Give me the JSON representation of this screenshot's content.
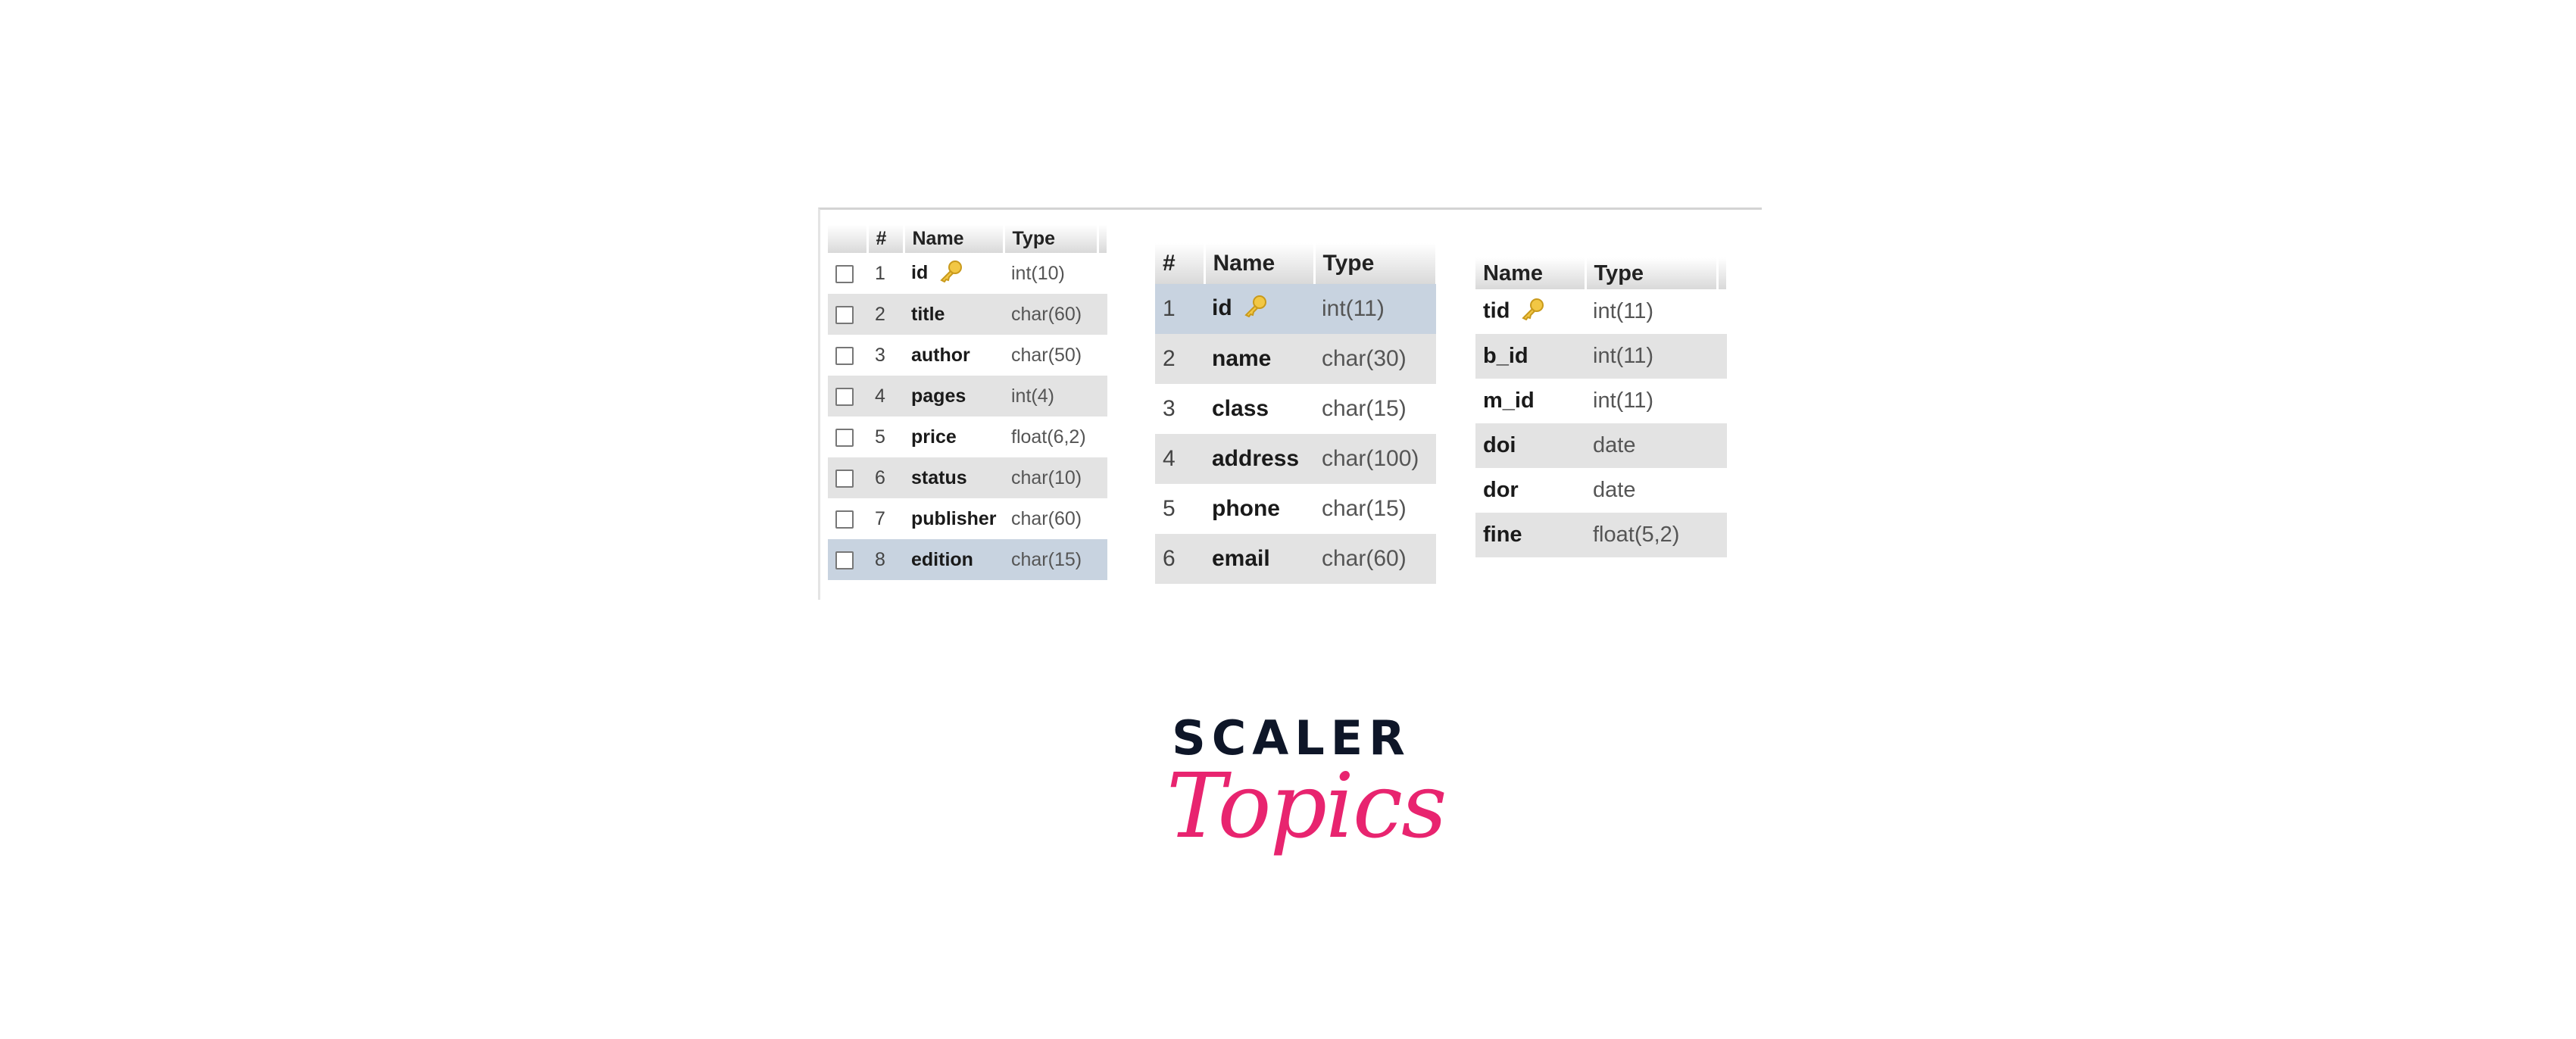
{
  "colors": {
    "accent_pink": "#e8246f",
    "logo_navy": "#0e1628",
    "row_gray": "#e3e3e3",
    "row_selected": "#c8d3e0"
  },
  "table1": {
    "headers": [
      "#",
      "Name",
      "Type"
    ],
    "rows": [
      {
        "num": "1",
        "name": "id",
        "type": "int(10)",
        "primary_key": true,
        "style": "odd"
      },
      {
        "num": "2",
        "name": "title",
        "type": "char(60)",
        "style": "even"
      },
      {
        "num": "3",
        "name": "author",
        "type": "char(50)",
        "style": "odd"
      },
      {
        "num": "4",
        "name": "pages",
        "type": "int(4)",
        "style": "even"
      },
      {
        "num": "5",
        "name": "price",
        "type": "float(6,2)",
        "style": "odd"
      },
      {
        "num": "6",
        "name": "status",
        "type": "char(10)",
        "style": "even"
      },
      {
        "num": "7",
        "name": "publisher",
        "type": "char(60)",
        "style": "odd"
      },
      {
        "num": "8",
        "name": "edition",
        "type": "char(15)",
        "style": "sel"
      }
    ]
  },
  "table2": {
    "headers": [
      "#",
      "Name",
      "Type"
    ],
    "rows": [
      {
        "num": "1",
        "name": "id",
        "type": "int(11)",
        "primary_key": true,
        "style": "sel"
      },
      {
        "num": "2",
        "name": "name",
        "type": "char(30)",
        "style": "even"
      },
      {
        "num": "3",
        "name": "class",
        "type": "char(15)",
        "style": "odd"
      },
      {
        "num": "4",
        "name": "address",
        "type": "char(100)",
        "style": "even"
      },
      {
        "num": "5",
        "name": "phone",
        "type": "char(15)",
        "style": "odd"
      },
      {
        "num": "6",
        "name": "email",
        "type": "char(60)",
        "style": "even"
      }
    ]
  },
  "table3": {
    "headers": [
      "Name",
      "Type"
    ],
    "rows": [
      {
        "name": "tid",
        "type": "int(11)",
        "primary_key": true,
        "style": "odd"
      },
      {
        "name": "b_id",
        "type": "int(11)",
        "style": "even"
      },
      {
        "name": "m_id",
        "type": "int(11)",
        "style": "odd"
      },
      {
        "name": "doi",
        "type": "date",
        "style": "even"
      },
      {
        "name": "dor",
        "type": "date",
        "style": "odd"
      },
      {
        "name": "fine",
        "type": "float(5,2)",
        "style": "even"
      }
    ]
  },
  "logo": {
    "line1": "SCALER",
    "line2": "Topics"
  }
}
